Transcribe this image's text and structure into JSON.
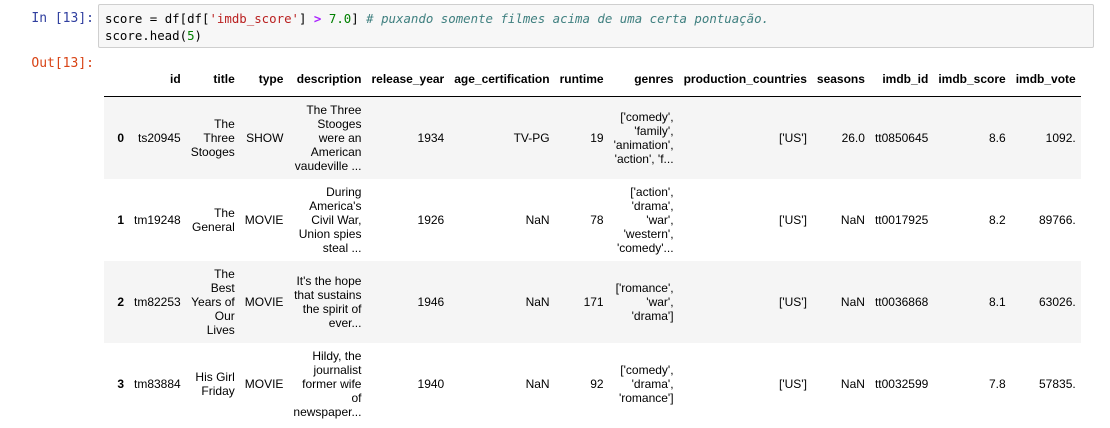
{
  "input_cell": {
    "prompt": "In [13]:",
    "code_line1": {
      "var": "score",
      "eq": " = ",
      "expr_a": "df[df[",
      "str": "'imdb_score'",
      "expr_b": "] ",
      "gt": ">",
      "sp": " ",
      "num": "7.0",
      "close": "] ",
      "comment": "# puxando somente filmes acima de uma certa pontuação."
    },
    "code_line2": {
      "text_a": "score.head(",
      "num": "5",
      "text_b": ")"
    }
  },
  "output_cell": {
    "prompt": "Out[13]:"
  },
  "table": {
    "columns": [
      "id",
      "title",
      "type",
      "description",
      "release_year",
      "age_certification",
      "runtime",
      "genres",
      "production_countries",
      "seasons",
      "imdb_id",
      "imdb_score",
      "imdb_vote"
    ],
    "rows": [
      {
        "index": "0",
        "id": "ts20945",
        "title": [
          "The",
          "Three",
          "Stooges"
        ],
        "type": "SHOW",
        "description": [
          "The Three",
          "Stooges",
          "were an",
          "American",
          "vaudeville ..."
        ],
        "release_year": "1934",
        "age_certification": "TV-PG",
        "runtime": "19",
        "genres": [
          "['comedy',",
          "'family',",
          "'animation',",
          "'action', 'f..."
        ],
        "production_countries": "['US']",
        "seasons": "26.0",
        "imdb_id": "tt0850645",
        "imdb_score": "8.6",
        "imdb_vote": "1092."
      },
      {
        "index": "1",
        "id": "tm19248",
        "title": [
          "The",
          "General"
        ],
        "type": "MOVIE",
        "description": [
          "During",
          "America's",
          "Civil War,",
          "Union spies",
          "steal ..."
        ],
        "release_year": "1926",
        "age_certification": "NaN",
        "runtime": "78",
        "genres": [
          "['action',",
          "'drama',",
          "'war',",
          "'western',",
          "'comedy'..."
        ],
        "production_countries": "['US']",
        "seasons": "NaN",
        "imdb_id": "tt0017925",
        "imdb_score": "8.2",
        "imdb_vote": "89766."
      },
      {
        "index": "2",
        "id": "tm82253",
        "title": [
          "The",
          "Best",
          "Years of",
          "Our",
          "Lives"
        ],
        "type": "MOVIE",
        "description": [
          "It's the hope",
          "that sustains",
          "the spirit of",
          "ever..."
        ],
        "release_year": "1946",
        "age_certification": "NaN",
        "runtime": "171",
        "genres": [
          "['romance',",
          "'war',",
          "'drama']"
        ],
        "production_countries": "['US']",
        "seasons": "NaN",
        "imdb_id": "tt0036868",
        "imdb_score": "8.1",
        "imdb_vote": "63026."
      },
      {
        "index": "3",
        "id": "tm83884",
        "title": [
          "His Girl",
          "Friday"
        ],
        "type": "MOVIE",
        "description": [
          "Hildy, the",
          "journalist",
          "former wife",
          "of",
          "newspaper..."
        ],
        "release_year": "1940",
        "age_certification": "NaN",
        "runtime": "92",
        "genres": [
          "['comedy',",
          "'drama',",
          "'romance']"
        ],
        "production_countries": "['US']",
        "seasons": "NaN",
        "imdb_id": "tt0032599",
        "imdb_score": "7.8",
        "imdb_vote": "57835."
      }
    ]
  }
}
